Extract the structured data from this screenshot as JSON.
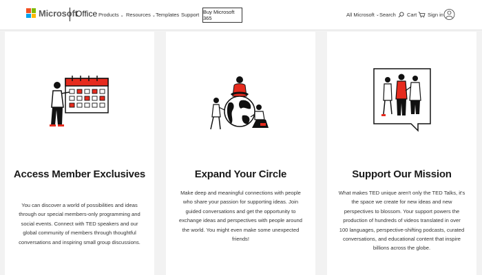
{
  "header": {
    "brand": "Microsoft",
    "product": "Office",
    "nav": [
      "Products",
      "Resources",
      "Templates",
      "Support"
    ],
    "nav_dropdowns": [
      true,
      true,
      false,
      false
    ],
    "cta": "Buy Microsoft 365",
    "all_microsoft": "All Microsoft",
    "search": "Search",
    "cart": "Cart",
    "sign_in": "Sign in",
    "logo_colors": [
      "#f25022",
      "#7fba00",
      "#00a4ef",
      "#ffb900"
    ]
  },
  "cards": [
    {
      "title": "Access Member Exclusives",
      "body": "You can discover a world of possibilities and ideas through our special members-only programming and social events. Connect with TED speakers and our global community of members through thoughtful conversations and inspiring small group discussions.",
      "icon": "calendar-person-illustration"
    },
    {
      "title": "Expand Your Circle",
      "body": "Make deep and meaningful connections with people who share your passion for supporting ideas. Join guided conversations and get the opportunity to exchange ideas and perspectives with people around the world. You might even make some unexpected friends!",
      "icon": "globe-people-illustration"
    },
    {
      "title": "Support Our Mission",
      "body": "What makes TED unique aren't only the TED Talks, it's the space we create for new ideas and new perspectives to blossom. Your support powers the production of hundreds of videos translated in over 100 languages, perspective-shifting podcasts, curated conversations, and educational content that inspire billions across the globe.",
      "icon": "speech-bubble-people-illustration"
    }
  ],
  "colors": {
    "accent": "#e62b1e",
    "ink": "#111111"
  }
}
